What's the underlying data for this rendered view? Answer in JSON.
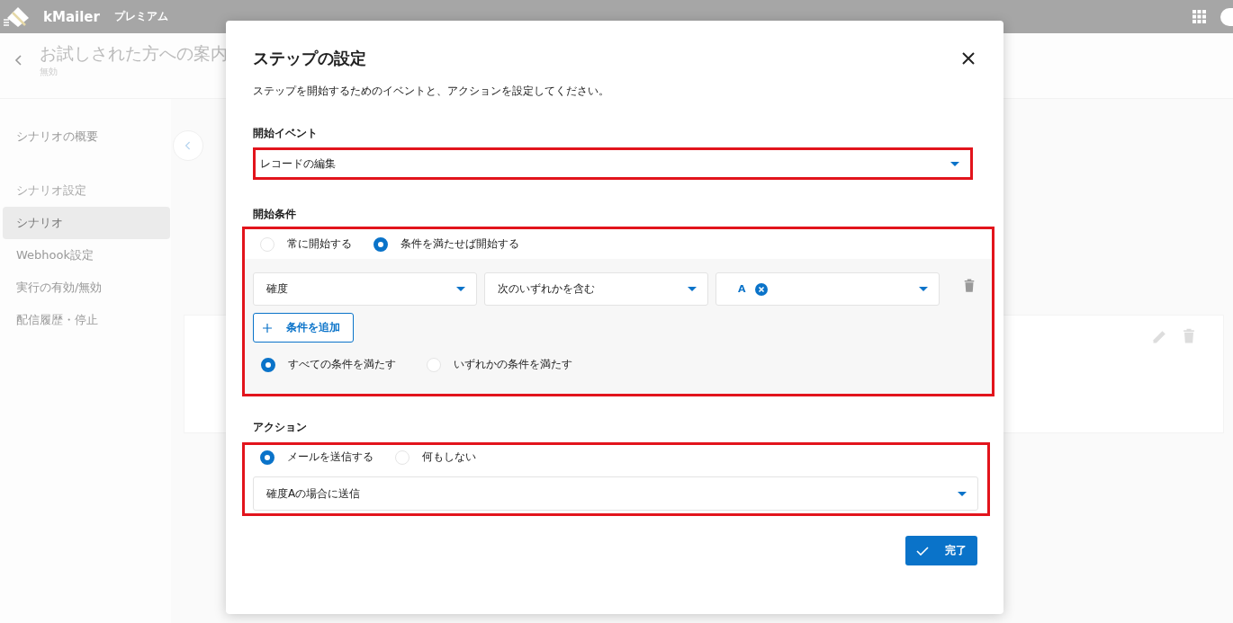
{
  "header": {
    "logo_text": "kMailer",
    "plan": "プレミアム"
  },
  "page": {
    "title": "お試しされた方への案内",
    "status": "無効"
  },
  "sidebar": {
    "items": [
      {
        "kind": "link",
        "label": "シナリオの概要",
        "selected": false
      },
      {
        "kind": "section",
        "label": "シナリオ設定",
        "selected": false
      },
      {
        "kind": "link",
        "label": "シナリオ",
        "selected": true
      },
      {
        "kind": "link",
        "label": "Webhook設定",
        "selected": false
      },
      {
        "kind": "link",
        "label": "実行の有効/無効",
        "selected": false
      },
      {
        "kind": "link",
        "label": "配信履歴・停止",
        "selected": false
      }
    ]
  },
  "modal": {
    "title": "ステップの設定",
    "description": "ステップを開始するためのイベントと、アクションを設定してください。",
    "start_event": {
      "label": "開始イベント",
      "value": "レコードの編集"
    },
    "start_condition": {
      "label": "開始条件",
      "options": [
        {
          "label": "常に開始する",
          "selected": false
        },
        {
          "label": "条件を満たせば開始する",
          "selected": true
        }
      ],
      "conditions": [
        {
          "field": "確度",
          "operator": "次のいずれかを含む",
          "values": [
            "A"
          ]
        }
      ],
      "add_button": "条件を追加",
      "match_options": [
        {
          "label": "すべての条件を満たす",
          "selected": true
        },
        {
          "label": "いずれかの条件を満たす",
          "selected": false
        }
      ]
    },
    "action": {
      "label": "アクション",
      "options": [
        {
          "label": "メールを送信する",
          "selected": true
        },
        {
          "label": "何もしない",
          "selected": false
        }
      ],
      "template": "確度Aの場合に送信"
    },
    "done_button": "完了"
  }
}
